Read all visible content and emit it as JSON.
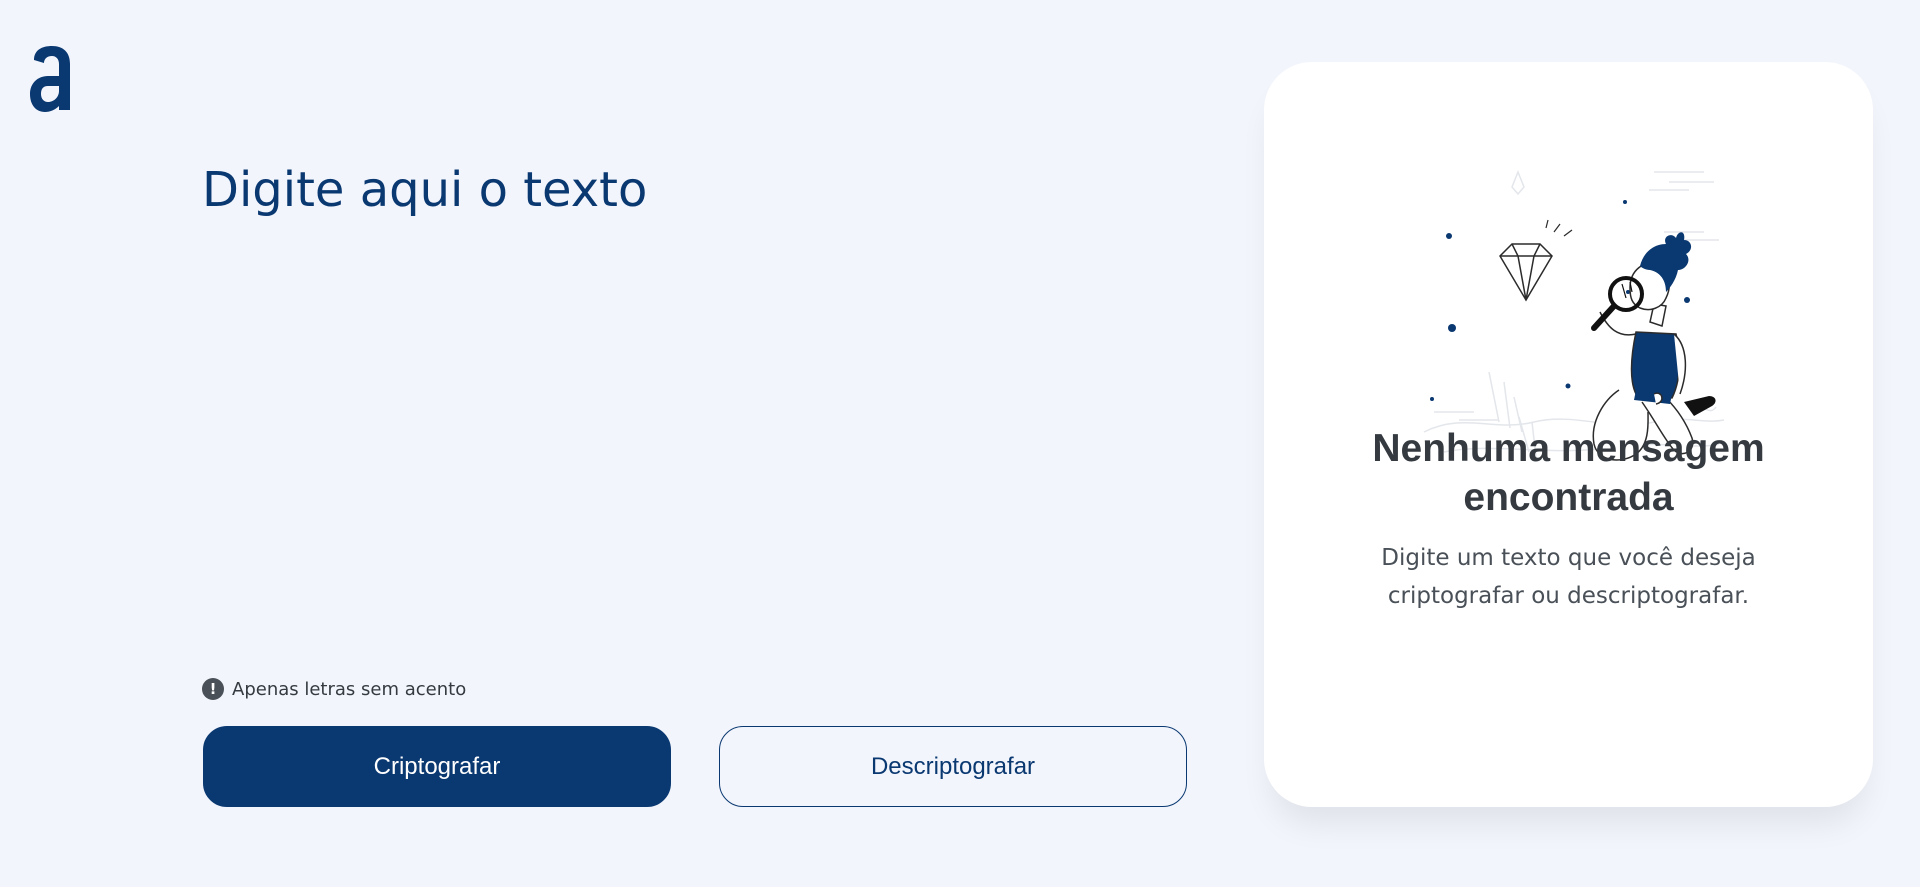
{
  "app": {
    "logo_icon": "alura-logo-icon",
    "accent_color": "#0a3871",
    "background_color": "#f2f5fc"
  },
  "input": {
    "placeholder": "Digite aqui o texto",
    "value": ""
  },
  "hint": {
    "icon": "exclamation-circle-icon",
    "text": "Apenas letras sem acento"
  },
  "buttons": {
    "encrypt_label": "Criptografar",
    "decrypt_label": "Descriptografar"
  },
  "output": {
    "illustration": "person-with-magnifying-glass-illustration",
    "title": "Nenhuma mensagem encontrada",
    "text": "Digite um texto que você deseja criptografar ou descriptografar."
  }
}
